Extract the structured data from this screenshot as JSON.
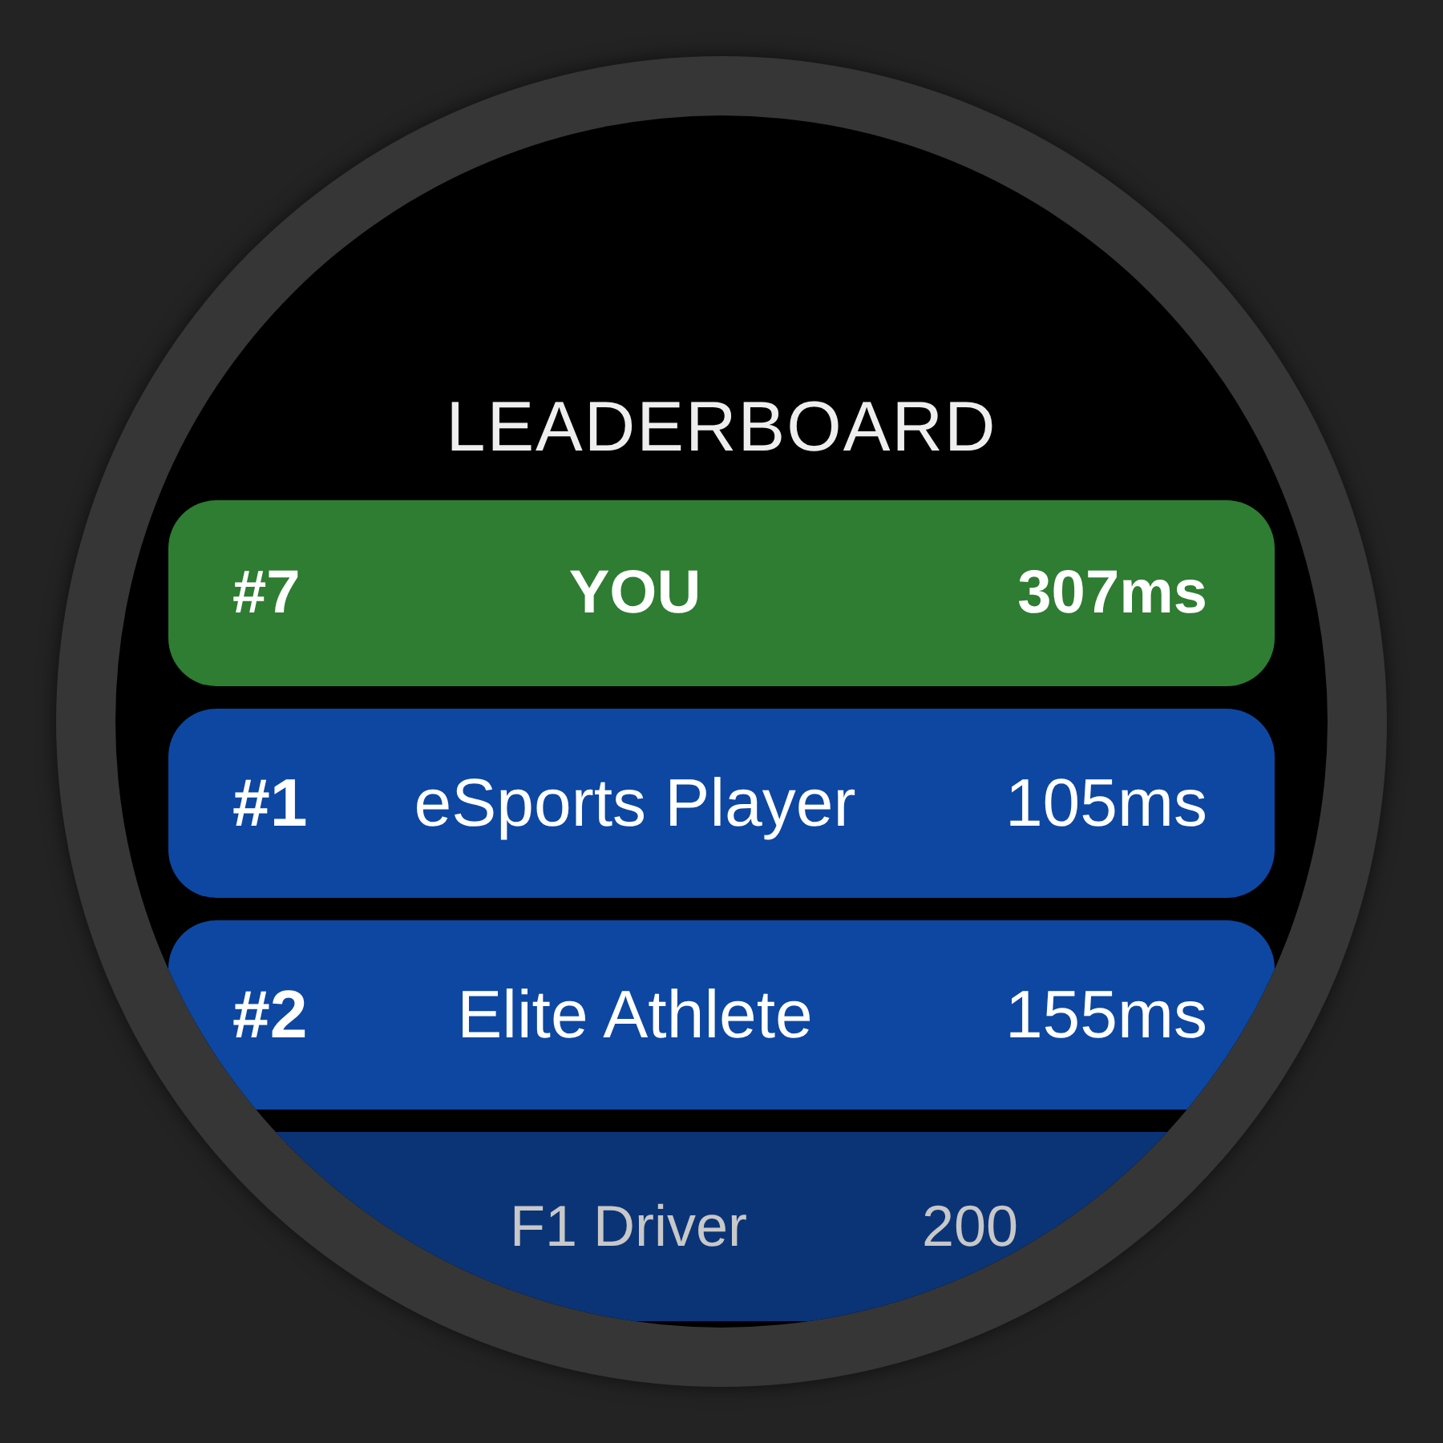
{
  "title": "LEADERBOARD",
  "rows": [
    {
      "kind": "you",
      "rank": "#7",
      "name": "YOU",
      "time": "307ms"
    },
    {
      "kind": "entry",
      "rank": "#1",
      "name": "eSports Player",
      "time": "105ms"
    },
    {
      "kind": "entry",
      "rank": "#2",
      "name": "Elite Athlete",
      "time": "155ms"
    },
    {
      "kind": "faded",
      "name": "F1 Driver",
      "time": "200"
    }
  ]
}
